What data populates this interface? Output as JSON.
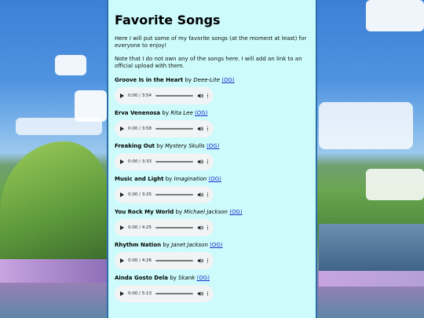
{
  "page": {
    "title": "Favorite Songs",
    "intro": "Here I will put some of my favorite songs (at the moment at least) for everyone to enjoy!",
    "note": "Note that I do not own any of the songs here. I will add an link to an official upload with them."
  },
  "songs": [
    {
      "title": "Groove Is in the Heart",
      "by": "by",
      "artist": "Deee-Lite",
      "link": "(OG)",
      "time": "0:00 / 3:54"
    },
    {
      "title": "Erva Venenosa",
      "by": "by",
      "artist": "Rita Lee",
      "link": "(OG)",
      "time": "0:00 / 3:58"
    },
    {
      "title": "Freaking Out",
      "by": "by",
      "artist": "Mystery Skulls",
      "link": "(OG)",
      "time": "0:00 / 3:33"
    },
    {
      "title": "Music and Light",
      "by": "by",
      "artist": "Imagination",
      "link": "(OG)",
      "time": "0:00 / 3:25"
    },
    {
      "title": "You Rock My World",
      "by": "by",
      "artist": "Michael Jackson",
      "link": "(OG)",
      "time": "0:00 / 4:25"
    },
    {
      "title": "Rhythm Nation",
      "by": "by",
      "artist": "Janet Jackson",
      "link": "(OG)",
      "time": "0:00 / 4:26"
    },
    {
      "title": "Ainda Gosto Dela",
      "by": "by",
      "artist": "Skank",
      "link": "(OG)",
      "time": "0:00 / 5:13"
    }
  ],
  "icons": {
    "play": "play-icon",
    "volume": "volume-icon",
    "more": "more-vert-icon"
  },
  "colors": {
    "panel": "#cdfbfb",
    "link": "#1a33cc",
    "player": "#f1f3f4"
  }
}
